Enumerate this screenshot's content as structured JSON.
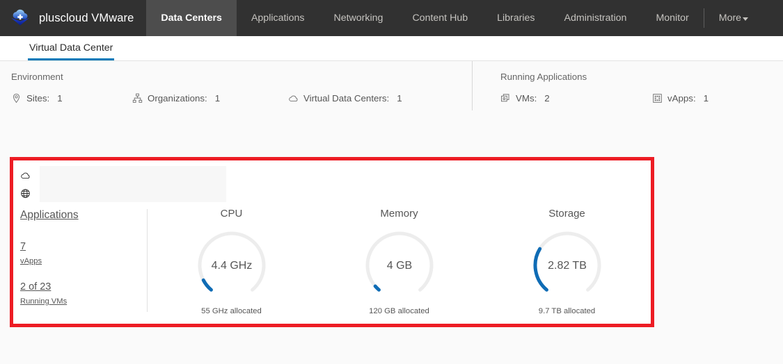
{
  "header": {
    "brand": "pluscloud VMware",
    "logo_icon": "cloud-plus-logo",
    "nav": [
      {
        "label": "Data Centers",
        "active": true
      },
      {
        "label": "Applications",
        "active": false
      },
      {
        "label": "Networking",
        "active": false
      },
      {
        "label": "Content Hub",
        "active": false
      },
      {
        "label": "Libraries",
        "active": false
      },
      {
        "label": "Administration",
        "active": false
      },
      {
        "label": "Monitor",
        "active": false
      }
    ],
    "more_label": "More",
    "more_icon": "chevron-down-icon"
  },
  "subtabs": [
    {
      "label": "Virtual Data Center",
      "active": true
    }
  ],
  "environment": {
    "title": "Environment",
    "stats": [
      {
        "icon": "map-pin-icon",
        "label": "Sites:",
        "value": "1"
      },
      {
        "icon": "organization-icon",
        "label": "Organizations:",
        "value": "1"
      },
      {
        "icon": "cloud-icon",
        "label": "Virtual Data Centers:",
        "value": "1"
      }
    ]
  },
  "running_applications": {
    "title": "Running Applications",
    "stats": [
      {
        "icon": "vm-icon",
        "label": "VMs:",
        "value": "2"
      },
      {
        "icon": "vapp-grid-icon",
        "label": "vApps:",
        "value": "1"
      }
    ]
  },
  "vdc_card": {
    "header_icons": [
      "cloud-icon",
      "globe-icon"
    ],
    "applications_link": "Applications",
    "kpis": [
      {
        "value": "7",
        "label": "vApps"
      },
      {
        "value": "2 of 23",
        "label": "Running VMs"
      }
    ],
    "gauges": [
      {
        "title": "CPU",
        "value": "4.4 GHz",
        "footer": "55 GHz allocated",
        "used": 4.4,
        "total": 55,
        "unit": "GHz",
        "percent": 8
      },
      {
        "title": "Memory",
        "value": "4 GB",
        "footer": "120 GB allocated",
        "used": 4,
        "total": 120,
        "unit": "GB",
        "percent": 3.3
      },
      {
        "title": "Storage",
        "value": "2.82 TB",
        "footer": "9.7 TB allocated",
        "used": 2.82,
        "total": 9.7,
        "unit": "TB",
        "percent": 29
      }
    ],
    "highlight_color": "#ed1c24",
    "arc_color": "#0f6cb5",
    "track_color": "#ededed"
  }
}
